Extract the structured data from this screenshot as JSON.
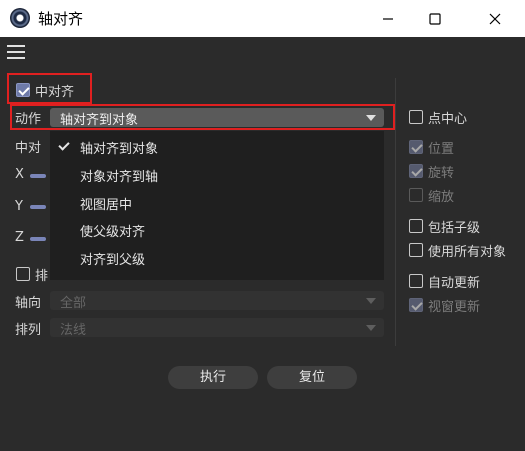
{
  "window": {
    "title": "轴对齐"
  },
  "left": {
    "center_align": {
      "label": "中对齐",
      "checked": true
    },
    "action": {
      "label": "动作",
      "selected": "轴对齐到对象"
    },
    "center_row_label_partial": "中对",
    "axes": {
      "x": "X",
      "y": "Y",
      "z": "Z"
    },
    "arrange_row_label_partial": "排",
    "axis_dir": {
      "label": "轴向",
      "value": "全部"
    },
    "arrange": {
      "label": "排列",
      "value": "法线"
    }
  },
  "dropdown": {
    "items": [
      "轴对齐到对象",
      "对象对齐到轴",
      "视图居中",
      "使父级对齐",
      "对齐到父级"
    ],
    "selected_index": 0
  },
  "right": {
    "point_center": {
      "label": "点中心",
      "checked": false
    },
    "position": {
      "label": "位置",
      "checked": true
    },
    "rotation": {
      "label": "旋转",
      "checked": true
    },
    "scale": {
      "label": "缩放",
      "checked": false
    },
    "include_children": {
      "label": "包括子级",
      "checked": false
    },
    "use_all_objects": {
      "label": "使用所有对象",
      "checked": false
    },
    "auto_update": {
      "label": "自动更新",
      "checked": false
    },
    "viewport_update": {
      "label": "视窗更新",
      "checked": true
    }
  },
  "footer": {
    "execute": "执行",
    "reset": "复位"
  }
}
